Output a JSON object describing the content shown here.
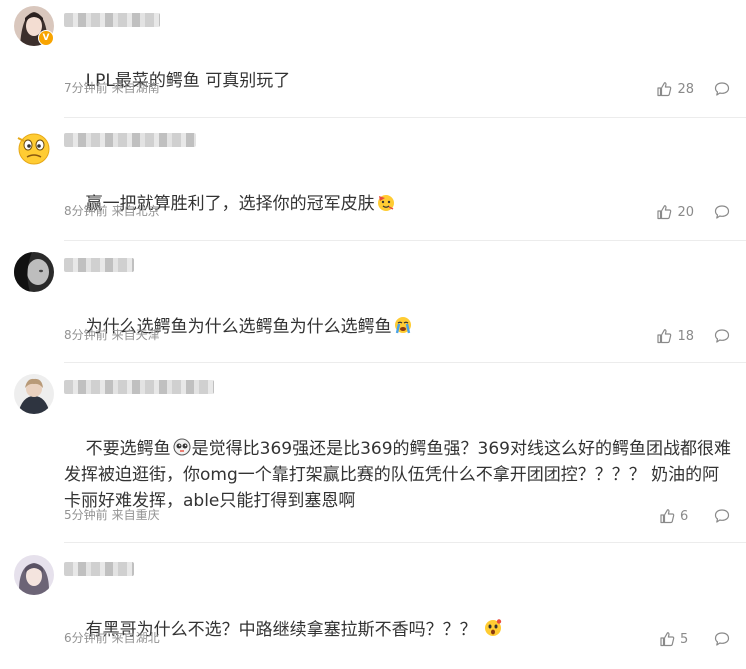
{
  "comments": [
    {
      "text": "LPL最菜的鳄鱼 可真别玩了",
      "time": "7分钟前",
      "location": "来自湖南",
      "likes": "28",
      "emoji": ""
    },
    {
      "text": "赢一把就算胜利了，选择你的冠军皮肤",
      "time": "8分钟前",
      "location": "来自北京",
      "likes": "20",
      "emoji": "party-face-emoji"
    },
    {
      "text": "为什么选鳄鱼为什么选鳄鱼为什么选鳄鱼",
      "time": "8分钟前",
      "location": "来自天津",
      "likes": "18",
      "emoji": "crying-face-emoji"
    },
    {
      "text_before_emoji": "不要选鳄鱼",
      "text_after_emoji": "是觉得比369强还是比369的鳄鱼强？369对线这么好的鳄鱼团战都很难发挥被迫逛街，你omg一个靠打架赢比赛的队伍凭什么不拿开团团控？？？？ 奶油的阿卡丽好难发挥，able只能打得到塞恩啊",
      "time": "5分钟前",
      "location": "来自重庆",
      "likes": "6",
      "emoji": "dizzy-face-emoji"
    },
    {
      "text": "有黑哥为什么不选？中路继续拿塞拉斯不香吗？？？ ",
      "time": "6分钟前",
      "location": "来自湖北",
      "likes": "5",
      "emoji": "surprised-face-emoji"
    }
  ],
  "icons": {
    "like": "thumbs-up-icon",
    "reply": "comment-bubble-icon",
    "verified": "verified-badge-icon"
  },
  "colors": {
    "text": "#333333",
    "meta": "#939393",
    "divider": "#ececec",
    "badge": "#f8a400"
  }
}
